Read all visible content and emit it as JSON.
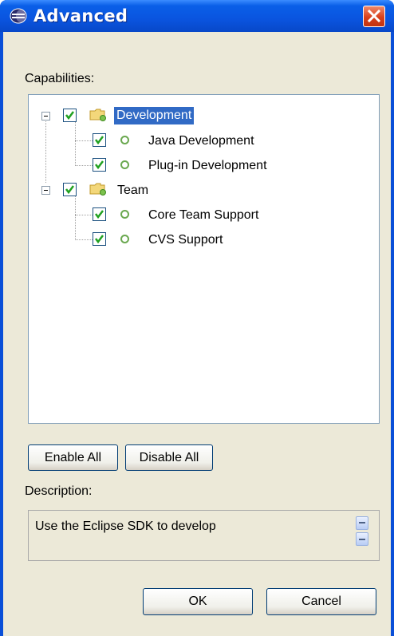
{
  "window": {
    "title": "Advanced",
    "title_icon": "eclipse-icon",
    "close_icon": "close-icon"
  },
  "capabilities": {
    "label": "Capabilities:",
    "tree": [
      {
        "label": "Development",
        "checked": true,
        "expanded": true,
        "selected": true,
        "icon": "folder-icon",
        "children": [
          {
            "label": "Java Development",
            "checked": true,
            "icon": "bullet-icon"
          },
          {
            "label": "Plug-in Development",
            "checked": true,
            "icon": "bullet-icon"
          }
        ]
      },
      {
        "label": "Team",
        "checked": true,
        "expanded": true,
        "selected": false,
        "icon": "folder-icon",
        "children": [
          {
            "label": "Core Team Support",
            "checked": true,
            "icon": "bullet-icon"
          },
          {
            "label": "CVS Support",
            "checked": true,
            "icon": "bullet-icon"
          }
        ]
      }
    ]
  },
  "buttons": {
    "enable_all": "Enable All",
    "disable_all": "Disable All",
    "ok": "OK",
    "cancel": "Cancel"
  },
  "description": {
    "label": "Description:",
    "text": "Use the Eclipse SDK to develop"
  },
  "colors": {
    "titlebar": "#0a54df",
    "dialog_bg": "#ece9d8",
    "selection": "#316ac5",
    "checkmark": "#21a121",
    "close_button": "#d8401c"
  }
}
